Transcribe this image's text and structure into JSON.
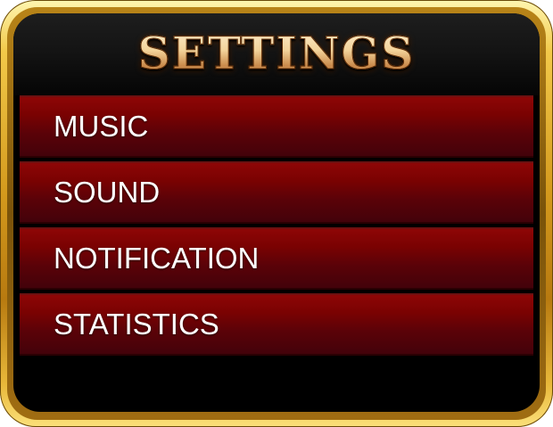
{
  "dialog": {
    "title": "SETTINGS"
  },
  "menu": {
    "items": [
      {
        "label": "MUSIC"
      },
      {
        "label": "SOUND"
      },
      {
        "label": "NOTIFICATION"
      },
      {
        "label": "STATISTICS"
      }
    ]
  },
  "colors": {
    "frame_gold": "#d49a1d",
    "panel_background": "#000000",
    "row_red": "#7a0202",
    "title_gold": "#f3d39a",
    "label_text": "#ffffff"
  }
}
